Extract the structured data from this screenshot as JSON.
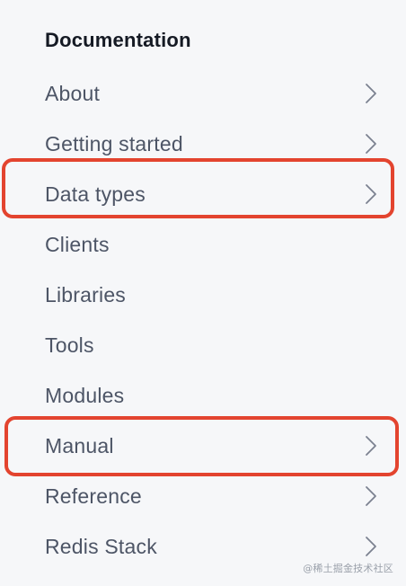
{
  "sidebar": {
    "title": "Documentation",
    "items": [
      {
        "label": "About",
        "has_chevron": true
      },
      {
        "label": "Getting started",
        "has_chevron": true
      },
      {
        "label": "Data types",
        "has_chevron": true,
        "highlighted": true
      },
      {
        "label": "Clients",
        "has_chevron": false
      },
      {
        "label": "Libraries",
        "has_chevron": false
      },
      {
        "label": "Tools",
        "has_chevron": false
      },
      {
        "label": "Modules",
        "has_chevron": false
      },
      {
        "label": "Manual",
        "has_chevron": true,
        "highlighted": true
      },
      {
        "label": "Reference",
        "has_chevron": true
      },
      {
        "label": "Redis Stack",
        "has_chevron": true
      }
    ]
  },
  "watermark": "@稀土掘金技术社区",
  "colors": {
    "background": "#f6f7f9",
    "title": "#151a24",
    "item_text": "#4d5566",
    "chevron": "#7b8190",
    "highlight": "#e3442f"
  },
  "icons": {
    "chevron": "chevron-right-icon"
  }
}
